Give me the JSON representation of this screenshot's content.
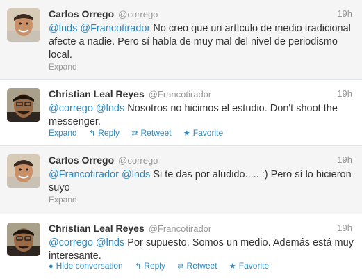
{
  "tweets": [
    {
      "fullname": "Carlos Orrego",
      "screenname": "@corrego",
      "time": "19h",
      "mention1": "@lnds",
      "mention2": "@Francotirador",
      "text_rest": "No creo que un artículo de medio tradicional afecte a nadie. Pero sí habla de muy mal del nivel de periodismo local.",
      "actions": {
        "expand": "Expand"
      }
    },
    {
      "fullname": "Christian Leal Reyes",
      "screenname": "@Francotirador",
      "time": "19h",
      "mention1": "@corrego",
      "mention2": "@lnds",
      "text_rest": "Nosotros no hicimos el estudio. Don't shoot the messenger.",
      "actions": {
        "expand": "Expand",
        "reply": "Reply",
        "retweet": "Retweet",
        "favorite": "Favorite"
      }
    },
    {
      "fullname": "Carlos Orrego",
      "screenname": "@corrego",
      "time": "19h",
      "mention1": "@Francotirador",
      "mention2": "@lnds",
      "text_rest": "Si te das por aludido..... :) Pero sí lo hicieron suyo",
      "actions": {
        "expand": "Expand"
      }
    },
    {
      "fullname": "Christian Leal Reyes",
      "screenname": "@Francotirador",
      "time": "19h",
      "mention1": "@corrego",
      "mention2": "@lnds",
      "text_rest": "Por supuesto. Somos un medio. Además está muy interesante.",
      "actions": {
        "hide": "Hide conversation",
        "reply": "Reply",
        "retweet": "Retweet",
        "favorite": "Favorite"
      }
    }
  ],
  "icons": {
    "reply": "reply-arrow-icon",
    "retweet": "retweet-icon",
    "favorite": "star-icon",
    "conversation": "speech-bubble-icon"
  },
  "colors": {
    "link": "#2c8ac2",
    "muted": "#999999",
    "text": "#333333",
    "hover_bg": "#f5f5f5"
  }
}
